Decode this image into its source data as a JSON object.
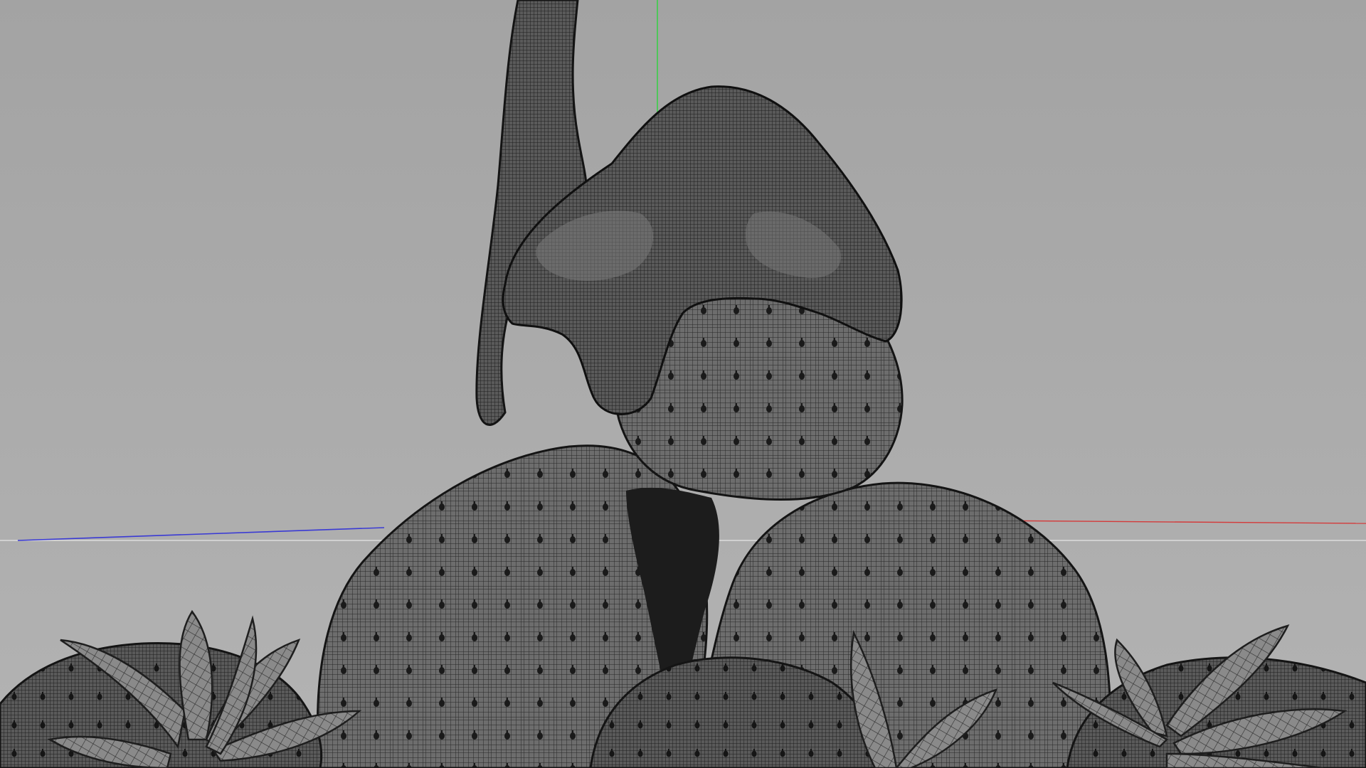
{
  "viewport": {
    "view": "perspective",
    "display_mode": "wireframe-on-shaded",
    "background_color": "#a8a8a8"
  },
  "axes": {
    "x_axis_color": "#d43a3a",
    "y_axis_color": "#2bd43a",
    "z_axis_color": "#3a3ad4",
    "horizon_color": "#e6e6e6"
  },
  "model": {
    "subject": "strawberries",
    "mesh_color": "#2a2a2a",
    "surface_color": "#6a6a6a"
  }
}
